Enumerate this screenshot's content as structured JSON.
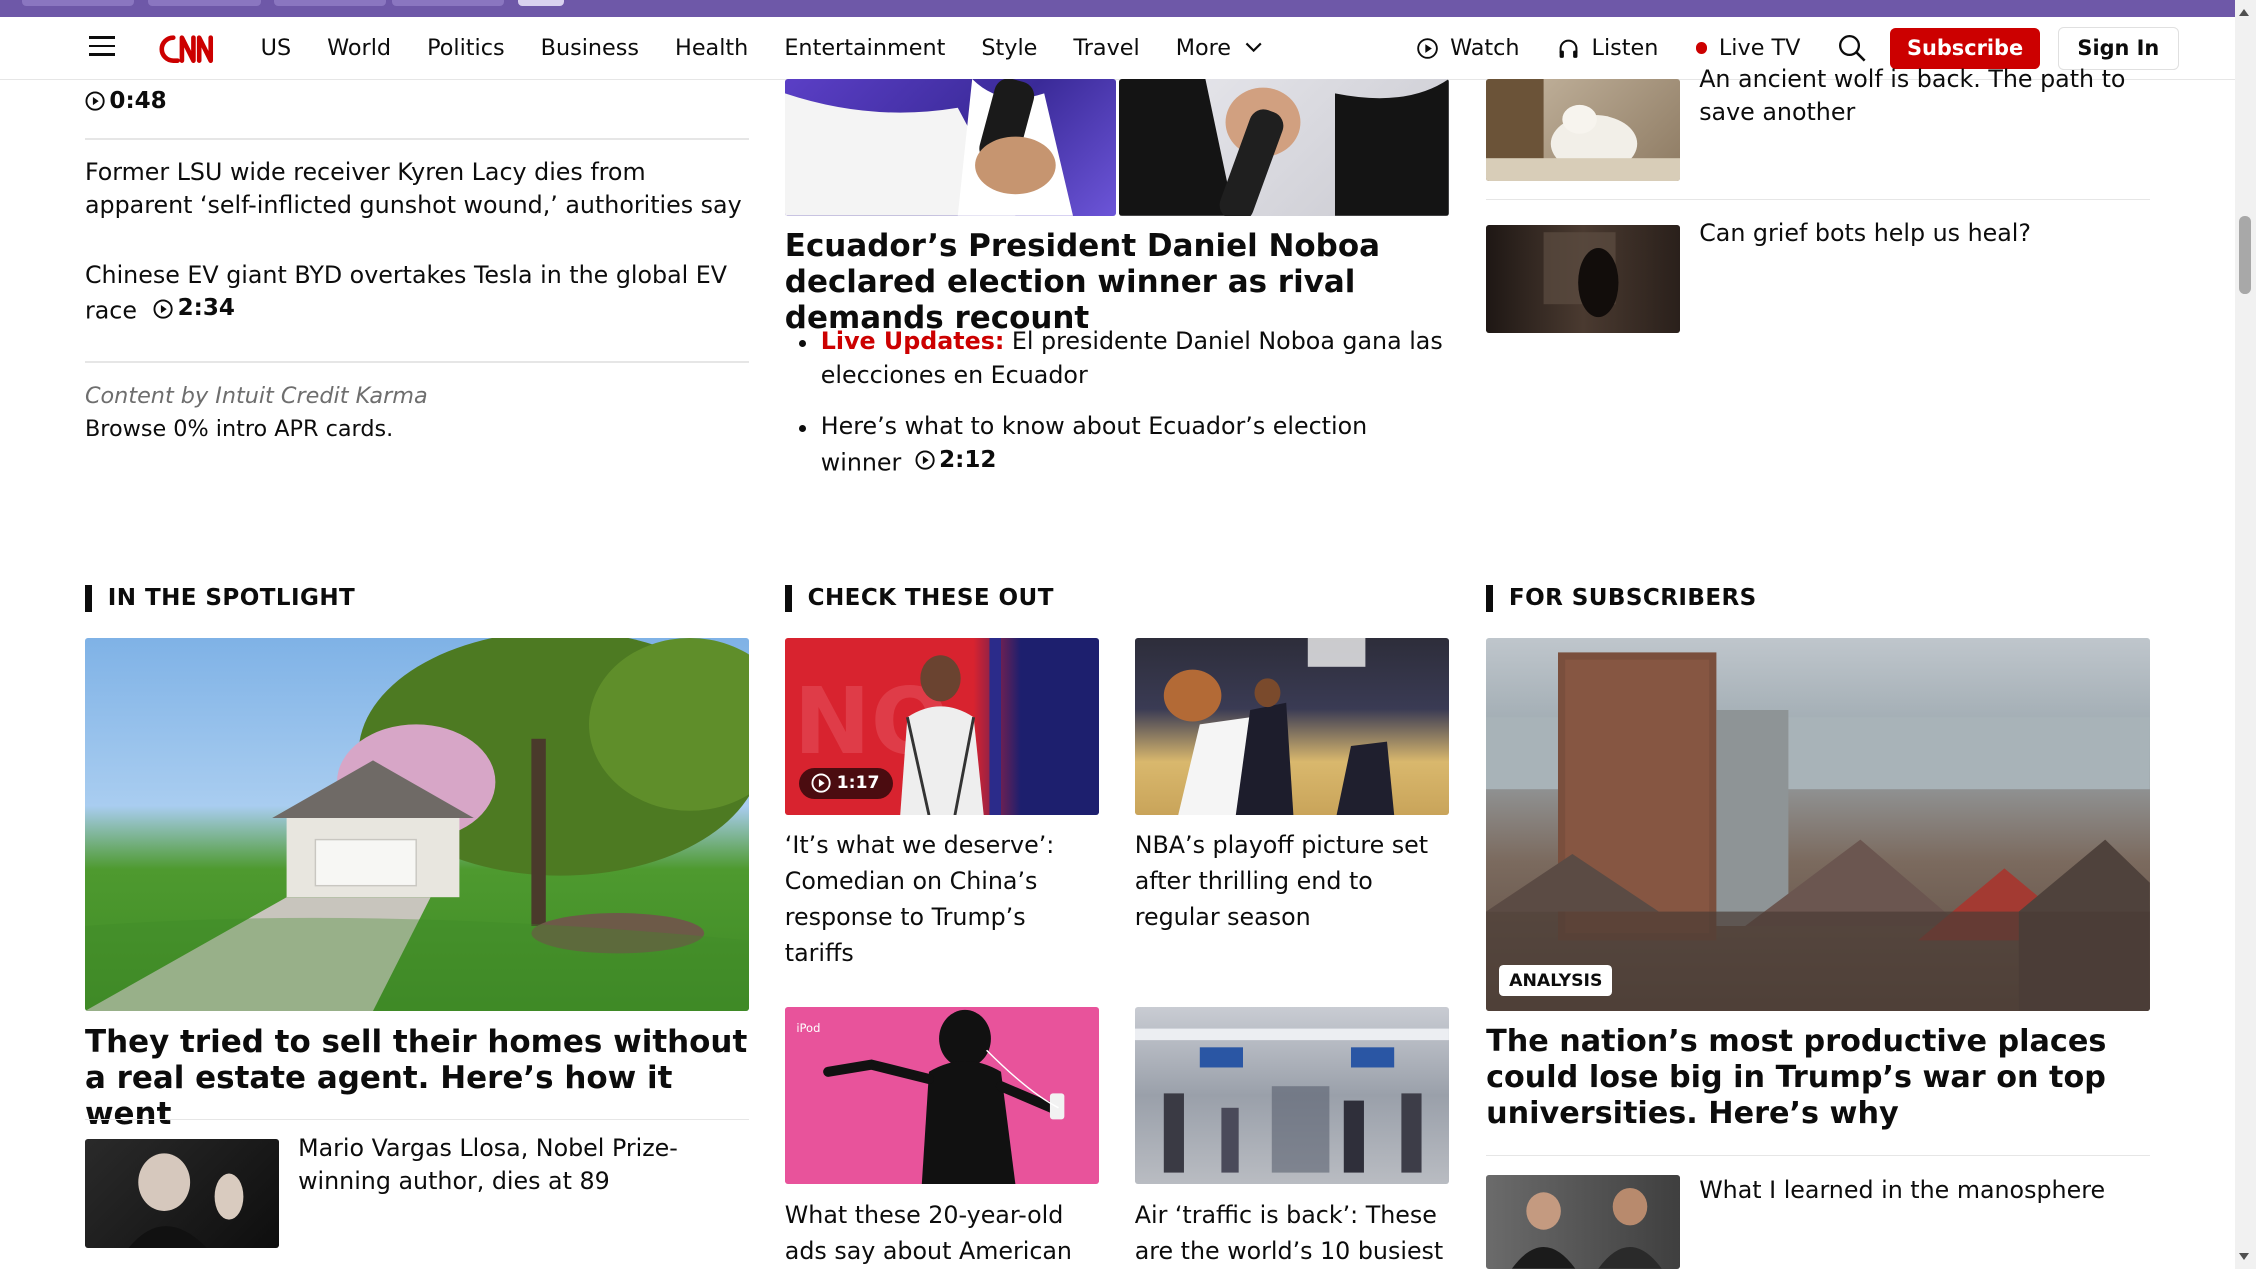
{
  "nav": {
    "links": [
      "US",
      "World",
      "Politics",
      "Business",
      "Health",
      "Entertainment",
      "Style",
      "Travel"
    ],
    "more_label": "More",
    "watch_label": "Watch",
    "listen_label": "Listen",
    "livetv_label": "Live TV",
    "subscribe_label": "Subscribe",
    "signin_label": "Sign In"
  },
  "left_col": {
    "top_duration": "0:48",
    "story1": "Former LSU wide receiver Kyren Lacy dies from apparent ‘self-inflicted gunshot wound,’ authorities say",
    "story2": "Chinese EV giant BYD overtakes Tesla in the global EV race",
    "story2_duration": "2:34",
    "sponsor_by": "Content by Intuit Credit Karma",
    "sponsor_text": "Browse 0% intro APR cards."
  },
  "center_col": {
    "headline": "Ecuador’s President Daniel Noboa declared election winner as rival demands recount",
    "bullet1_live": "Live Updates:",
    "bullet1_text": " El presidente Daniel Noboa gana las elecciones en Ecuador",
    "bullet2_text": "Here’s what to know about Ecuador’s election winner",
    "bullet2_duration": "2:12"
  },
  "right_col": {
    "story1": "An ancient wolf is back. The path to save another",
    "story2": "Can grief bots help us heal?"
  },
  "spotlight": {
    "heading": "IN THE SPOTLIGHT",
    "main_headline": "They tried to sell their homes without a real estate agent. Here’s how it went",
    "story1": "Mario Vargas Llosa, Nobel Prize-winning author, dies at 89"
  },
  "check": {
    "heading": "CHECK THESE OUT",
    "card1_duration": "1:17",
    "card1": "‘It’s what we deserve’: Comedian on China’s response to Trump’s tariffs",
    "card2": "NBA’s playoff picture set after thrilling end to regular season",
    "card3": "What these 20-year-old ads say about American",
    "card4": "Air ‘traffic is back’: These are the world’s 10 busiest",
    "ipod_label": "iPod"
  },
  "subscribers": {
    "heading": "FOR SUBSCRIBERS",
    "badge": "ANALYSIS",
    "main_headline": "The nation’s most productive places could lose big in Trump’s war on top universities. Here’s why",
    "story1": "What I learned in the manosphere"
  },
  "colors": {
    "cnn_red": "#cc0000",
    "browser_bar": "#6e58a8"
  }
}
